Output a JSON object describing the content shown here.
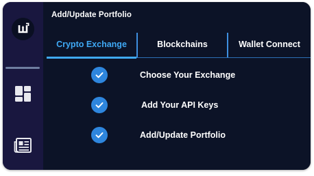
{
  "colors": {
    "sidebar_bg": "#19173f",
    "content_bg": "#0c1327",
    "accent": "#3fa9f5",
    "check_bg": "#2e86de",
    "text": "#ffffff"
  },
  "sidebar": {
    "logo_icon": "app-logo-icon",
    "items": [
      {
        "icon": "dashboard-icon"
      },
      {
        "icon": "news-icon"
      }
    ]
  },
  "header": {
    "title": "Add/Update Portfolio"
  },
  "tabs": [
    {
      "label": "Crypto Exchange",
      "active": true
    },
    {
      "label": "Blockchains",
      "active": false
    },
    {
      "label": "Wallet Connect",
      "active": false
    }
  ],
  "steps": [
    {
      "label": "Choose Your Exchange",
      "completed": true,
      "icon": "check-icon"
    },
    {
      "label": "Add Your API Keys",
      "completed": true,
      "icon": "check-icon"
    },
    {
      "label": "Add/Update Portfolio",
      "completed": true,
      "icon": "check-icon"
    }
  ]
}
